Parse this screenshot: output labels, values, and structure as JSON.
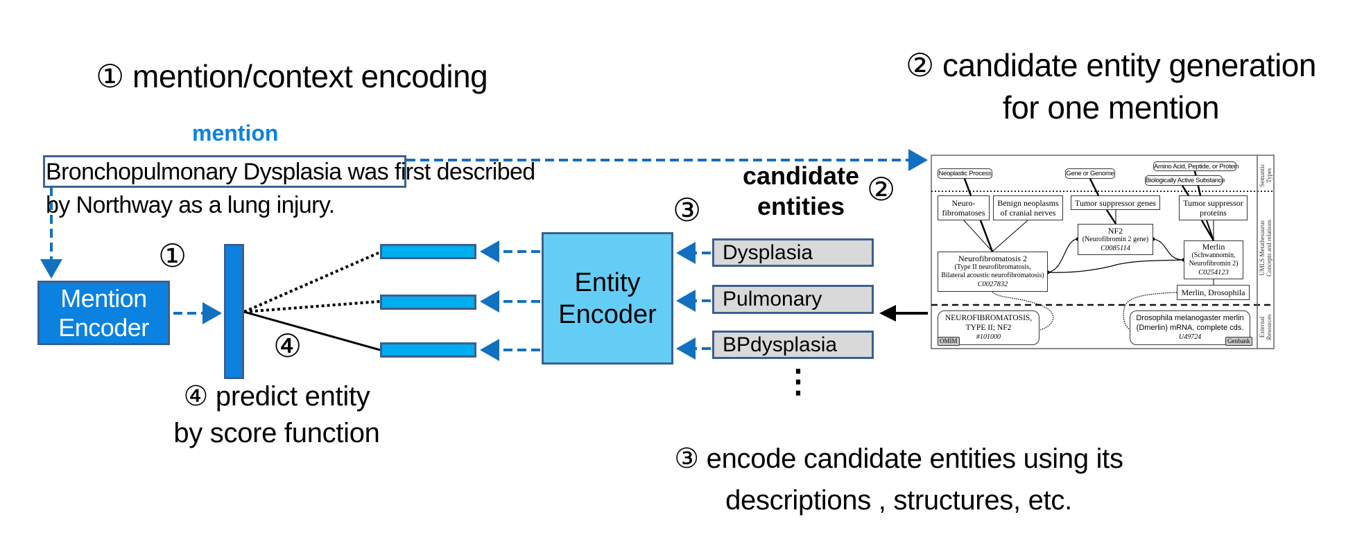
{
  "titles": {
    "step1": "① mention/context encoding",
    "step2_line1": "② candidate entity generation",
    "step2_line2": "for one mention",
    "step3_line1": "③ encode candidate entities using its",
    "step3_line2": "descriptions , structures, etc.",
    "step4_line1": "④ predict entity",
    "step4_line2": "by score function"
  },
  "mention": {
    "label": "mention",
    "highlighted_text": "Bronchopulmonary Dysplasia",
    "rest_line1": " was first described",
    "line2": "by Northway as a lung injury."
  },
  "markers": {
    "one": "①",
    "two": "②",
    "three": "③",
    "four": "④"
  },
  "encoders": {
    "mention_encoder_line1": "Mention",
    "mention_encoder_line2": "Encoder",
    "entity_encoder_line1": "Entity",
    "entity_encoder_line2": "Encoder"
  },
  "candidates": {
    "title_line1": "candidate",
    "title_line2": "entities",
    "items": [
      "Dysplasia",
      "Pulmonary",
      "BPdysplasia"
    ],
    "ellipsis": "⋮"
  },
  "umls": {
    "semantic_types": [
      "Neoplastic Process",
      "Gene or Genome",
      "Amino Acid, Peptide, or Protein",
      "Biologically Active Substance"
    ],
    "concepts": {
      "neurofibromatoses": [
        "Neuro-",
        "fibromatoses"
      ],
      "benign": [
        "Benign neoplasms",
        "of cranial nerves"
      ],
      "tumor_genes": "Tumor suppressor genes",
      "tumor_proteins": [
        "Tumor suppressor",
        "proteins"
      ],
      "nf2": {
        "name": "NF2",
        "synonyms": "(Neurofibromin 2 gene)",
        "code": "C0085114"
      },
      "neurofibromatosis2": {
        "name": "Neurofibromatosis 2",
        "syn1": "(Type II neurofibromatosis,",
        "syn2": "Bilateral acoustic neurofibromatosis)",
        "code": "C0027832"
      },
      "merlin": {
        "name": "Merlin",
        "syn1": "(Schwannomin,",
        "syn2": "Neurofibromin 2)",
        "code": "C0254123"
      },
      "merlin_drosophila": "Merlin, Drosophila"
    },
    "external": {
      "omim": {
        "line1": "NEUROFIBROMATOSIS,",
        "line2": "TYPE II; NF2",
        "code": "#101000",
        "tag": "OMIM"
      },
      "genbank": {
        "line1": "Drosophila melanogaster merlin",
        "line2": "(Dmerlin) mRNA, complete cds.",
        "code": "U49724",
        "tag": "Genbank"
      }
    },
    "side_labels": {
      "semantic": [
        "Semantic",
        "Types"
      ],
      "metathesaurus": [
        "UMLS Metathesaurus",
        "Concepts and relations"
      ],
      "external": [
        "External",
        "Resources"
      ]
    }
  },
  "colors": {
    "accent_blue": "#0b82e0",
    "arrow_blue": "#1270c0",
    "entity_encoder": "#64cdf5",
    "entity_vector": "#00adef",
    "candidate_fill": "#d9d9d9",
    "border": "#3c5f8f"
  }
}
